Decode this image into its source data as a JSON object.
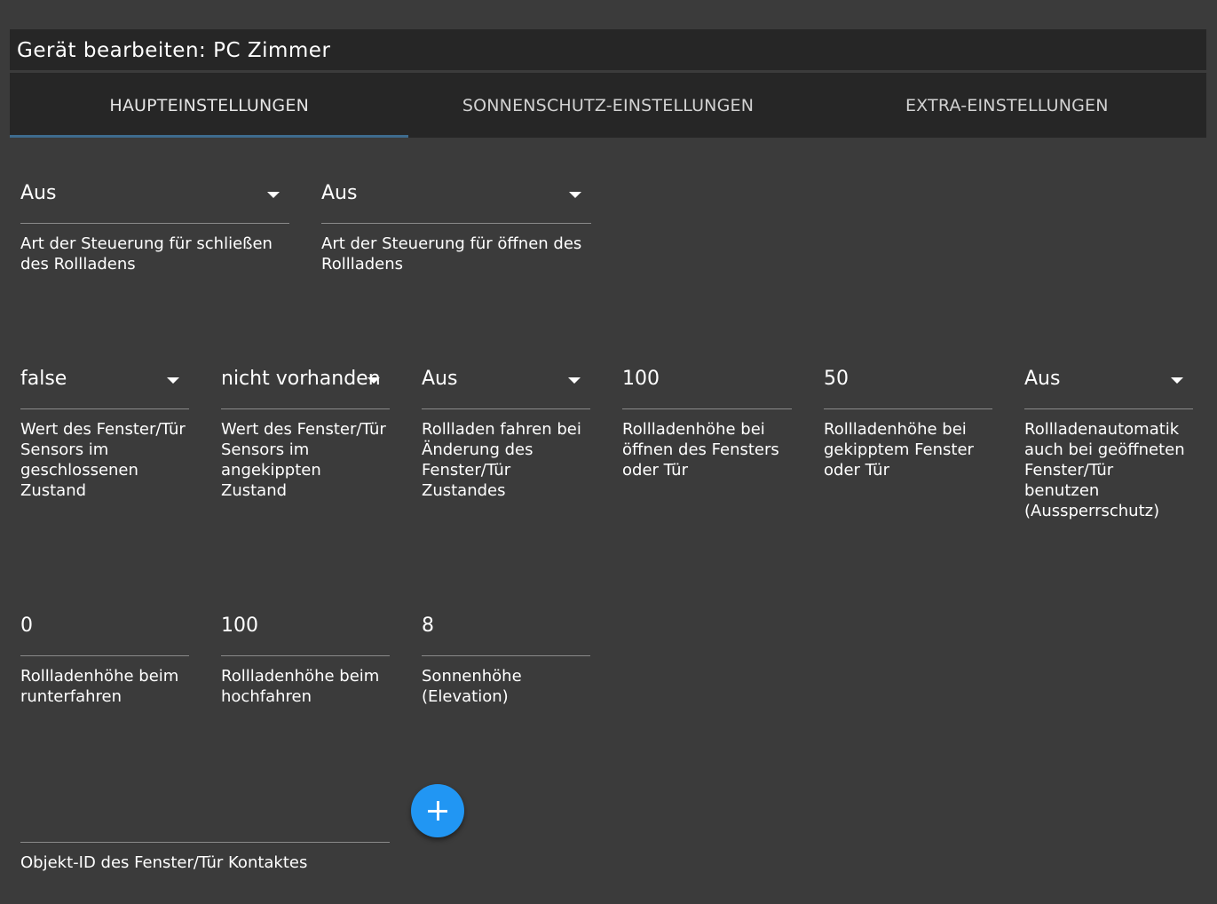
{
  "dialog": {
    "title": "Gerät bearbeiten: PC Zimmer"
  },
  "tabs": [
    {
      "label": "HAUPTEINSTELLUNGEN",
      "active": true
    },
    {
      "label": "SONNENSCHUTZ-EINSTELLUNGEN",
      "active": false
    },
    {
      "label": "EXTRA-EINSTELLUNGEN",
      "active": false
    }
  ],
  "row1": [
    {
      "value": "Aus",
      "label": "Art der Steuerung für schließen des Rollladens",
      "type": "select"
    },
    {
      "value": "Aus",
      "label": "Art der Steuerung für öffnen des Rollladens",
      "type": "select"
    }
  ],
  "row2": [
    {
      "value": "false",
      "label": "Wert des Fenster/Tür Sensors im geschlossenen Zustand",
      "type": "select"
    },
    {
      "value": "nicht vorhanden",
      "label": "Wert des Fenster/Tür Sensors im angekippten Zustand",
      "type": "select"
    },
    {
      "value": "Aus",
      "label": "Rollladen fahren bei Änderung des Fenster/Tür Zustandes",
      "type": "select"
    },
    {
      "value": "100",
      "label": "Rollladenhöhe bei öffnen des Fensters oder Tür",
      "type": "text"
    },
    {
      "value": "50",
      "label": "Rollladenhöhe bei gekipptem Fenster oder Tür",
      "type": "text"
    },
    {
      "value": "Aus",
      "label": "Rollladenautomatik auch bei geöffneten Fenster/Tür benutzen (Aussperrschutz)",
      "type": "select"
    }
  ],
  "row3": [
    {
      "value": "0",
      "label": "Rollladenhöhe beim runterfahren",
      "type": "text"
    },
    {
      "value": "100",
      "label": "Rollladenhöhe beim hochfahren",
      "type": "text"
    },
    {
      "value": "8",
      "label": "Sonnenhöhe (Elevation)",
      "type": "text"
    }
  ],
  "object_id": {
    "value": "",
    "label": "Objekt-ID des Fenster/Tür Kontaktes"
  },
  "add_button": {
    "icon": "plus-icon",
    "color": "#2196f3"
  }
}
